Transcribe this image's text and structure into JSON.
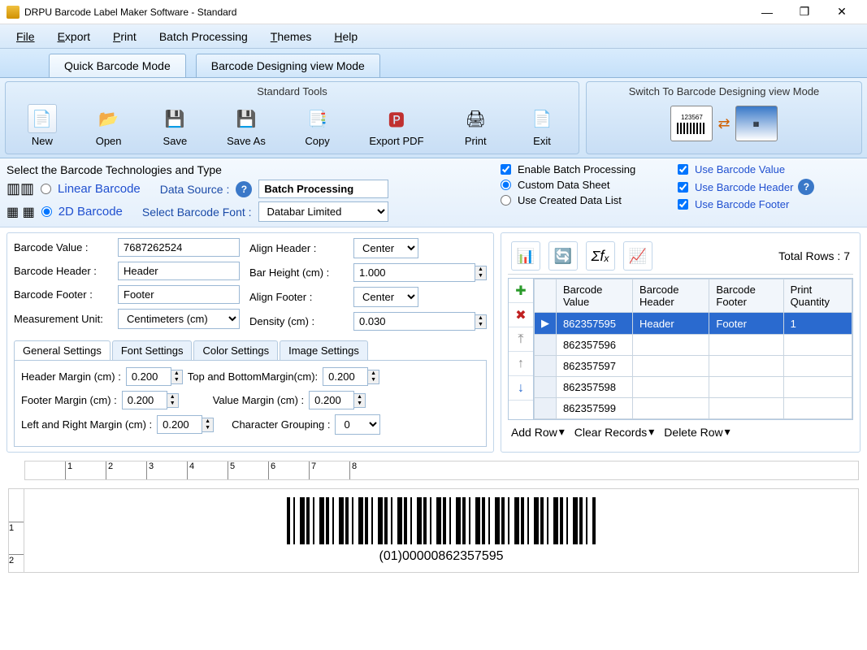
{
  "window": {
    "title": "DRPU Barcode Label Maker Software - Standard"
  },
  "menu": {
    "file": "File",
    "export": "Export",
    "print": "Print",
    "batch": "Batch Processing",
    "themes": "Themes",
    "help": "Help"
  },
  "tabs": {
    "quick": "Quick Barcode Mode",
    "design": "Barcode Designing view Mode"
  },
  "toolgroup": {
    "standard_title": "Standard Tools",
    "new": "New",
    "open": "Open",
    "save": "Save",
    "saveas": "Save As",
    "copy": "Copy",
    "exportpdf": "Export PDF",
    "print": "Print",
    "exit": "Exit",
    "switch_title": "Switch To Barcode Designing view Mode"
  },
  "barcode_type": {
    "select_label": "Select the Barcode Technologies and Type",
    "linear": "Linear Barcode",
    "twod": "2D Barcode",
    "datasource_label": "Data Source :",
    "datasource_value": "Batch Processing",
    "font_label": "Select Barcode Font :",
    "font_value": "Databar Limited"
  },
  "batch": {
    "enable": "Enable Batch Processing",
    "custom": "Custom Data Sheet",
    "created": "Use Created Data List",
    "use_value": "Use Barcode Value",
    "use_header": "Use Barcode Header",
    "use_footer": "Use Barcode Footer"
  },
  "fields": {
    "value_label": "Barcode Value :",
    "value": "7687262524",
    "header_label": "Barcode Header :",
    "header": "Header",
    "footer_label": "Barcode Footer :",
    "footer": "Footer",
    "unit_label": "Measurement Unit:",
    "unit": "Centimeters (cm)",
    "align_header_label": "Align Header  :",
    "align_header": "Center",
    "bar_height_label": "Bar Height (cm) :",
    "bar_height": "1.000",
    "align_footer_label": "Align Footer  :",
    "align_footer": "Center",
    "density_label": "Density (cm) :",
    "density": "0.030"
  },
  "subtabs": {
    "general": "General Settings",
    "font": "Font Settings",
    "color": "Color Settings",
    "image": "Image Settings"
  },
  "margins": {
    "header_label": "Header Margin (cm) :",
    "header": "0.200",
    "topbottom_label": "Top and BottomMargin(cm):",
    "topbottom": "0.200",
    "footer_label": "Footer Margin (cm) :",
    "footer": "0.200",
    "value_label": "Value Margin (cm) :",
    "value": "0.200",
    "leftright_label": "Left and Right Margin (cm) :",
    "leftright": "0.200",
    "chargroup_label": "Character Grouping :",
    "chargroup": "0"
  },
  "grid": {
    "total_label": "Total Rows : 7",
    "col_value": "Barcode Value",
    "col_header": "Barcode Header",
    "col_footer": "Barcode Footer",
    "col_qty": "Print Quantity",
    "rows": [
      {
        "v": "862357595",
        "h": "Header",
        "f": "Footer",
        "q": "1"
      },
      {
        "v": "862357596",
        "h": "",
        "f": "",
        "q": ""
      },
      {
        "v": "862357597",
        "h": "",
        "f": "",
        "q": ""
      },
      {
        "v": "862357598",
        "h": "",
        "f": "",
        "q": ""
      },
      {
        "v": "862357599",
        "h": "",
        "f": "",
        "q": ""
      }
    ],
    "addrow": "Add Row",
    "clear": "Clear Records",
    "delrow": "Delete Row"
  },
  "preview": {
    "text": "(01)00000862357595"
  }
}
